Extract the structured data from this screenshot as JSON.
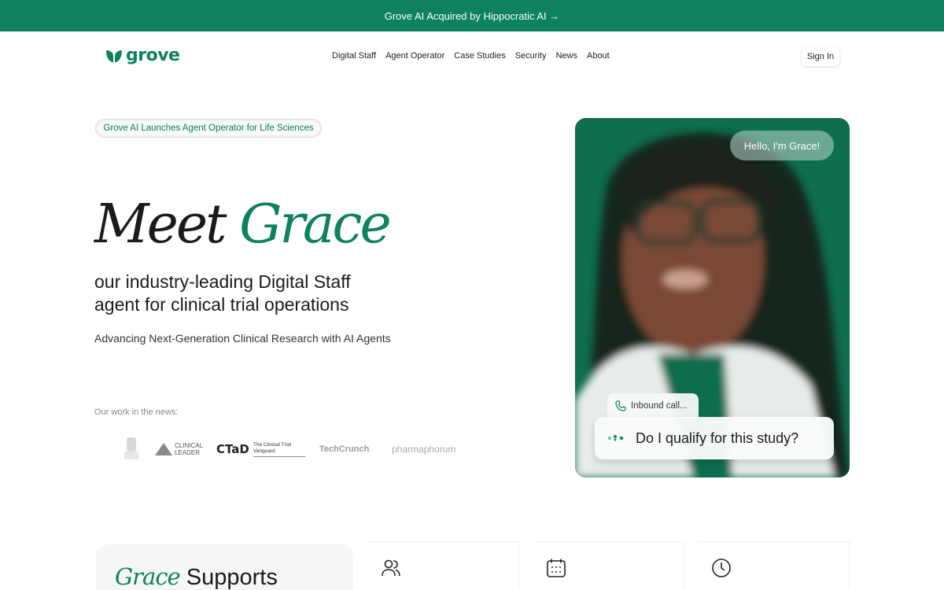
{
  "banner": {
    "text": "Grove AI Acquired by Hippocratic AI →"
  },
  "nav": {
    "logo_text": "grove",
    "links": [
      "Digital Staff",
      "Agent Operator",
      "Case Studies",
      "Security",
      "News",
      "About"
    ],
    "signin": "Sign In"
  },
  "hero": {
    "pill": "Grove AI Launches Agent Operator for Life Sciences",
    "title_meet": "Meet",
    "title_grace": "Grace",
    "subtitle": "our industry-leading Digital Staff agent for clinical trial operations",
    "tagline": "Advancing Next-Generation Clinical Research with AI Agents",
    "news_label": "Our work in the news:",
    "news_logos": [
      "CLINICAL LEADER",
      "CTaD",
      "The Clinical Trial Vanguard",
      "TechCrunch",
      "pharmaphorum"
    ],
    "card": {
      "hello": "Hello, I'm Grace!",
      "inbound": "Inbound call...",
      "question": "Do I qualify for this study?"
    }
  },
  "features": {
    "title_grace": "Grace",
    "title_rest": "Supports",
    "icons": [
      "people-icon",
      "calendar-icon",
      "clock-icon"
    ]
  },
  "colors": {
    "brand": "#0e8160",
    "card_bg": "#0f6d50"
  }
}
